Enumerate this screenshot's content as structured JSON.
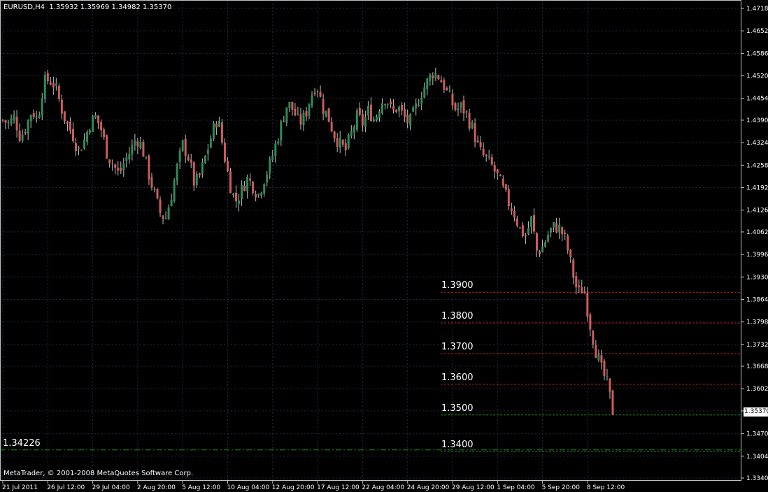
{
  "header": {
    "symbol": "EURUSD,H4",
    "ohlc": "1.35932 1.35969 1.34982 1.35370"
  },
  "footer": {
    "copyright": "MetaTrader, © 2001-2008 MetaQuotes Software Corp."
  },
  "current_price": {
    "label": "1.35370",
    "value": 1.3537
  },
  "colors": {
    "background": "#000000",
    "grid": "#1c2c3c",
    "frame": "#c0c0c0",
    "bull_candle": "#2e8b57",
    "bear_candle": "#cd5c5c",
    "wick": "#c0c0c0",
    "level_line": "#b22222",
    "support_line": "#228b22",
    "price_box": "#ffffff"
  },
  "levels": [
    {
      "label": "1.3900",
      "value": 1.3885,
      "style": "red-dotted"
    },
    {
      "label": "1.3800",
      "value": 1.3795,
      "style": "red-dotted"
    },
    {
      "label": "1.3700",
      "value": 1.3705,
      "style": "red-dotted"
    },
    {
      "label": "1.3600",
      "value": 1.3615,
      "style": "red-dotted"
    },
    {
      "label": "1.3500",
      "value": 1.3525,
      "style": "green-dotted"
    },
    {
      "label": "1.3400",
      "value": 1.3418,
      "style": "green-dotted"
    }
  ],
  "support": {
    "label": "1.34226",
    "value": 1.34226
  },
  "chart_data": {
    "type": "candlestick",
    "y_axis": {
      "ticks": [
        "1.47180",
        "1.46520",
        "1.45860",
        "1.45200",
        "1.44540",
        "1.43900",
        "1.43240",
        "1.42580",
        "1.41920",
        "1.41260",
        "1.40620",
        "1.39960",
        "1.39300",
        "1.38640",
        "1.37980",
        "1.37320",
        "1.36680",
        "1.36020",
        "1.35370",
        "1.34700",
        "1.34040",
        "1.33400"
      ],
      "range": [
        1.334,
        1.4718
      ]
    },
    "x_axis": {
      "ticks": [
        "21 Jul 2011",
        "26 Jul 12:00",
        "29 Jul 04:00",
        "2 Aug 20:00",
        "5 Aug 12:00",
        "10 Aug 04:00",
        "12 Aug 20:00",
        "17 Aug 12:00",
        "22 Aug 04:00",
        "24 Aug 20:00",
        "29 Aug 12:00",
        "1 Sep 04:00",
        "5 Sep 20:00",
        "8 Sep 12:00"
      ]
    },
    "close_path": [
      1.439,
      1.438,
      1.44,
      1.434,
      1.437,
      1.442,
      1.439,
      1.45,
      1.451,
      1.449,
      1.443,
      1.438,
      1.435,
      1.43,
      1.433,
      1.438,
      1.44,
      1.436,
      1.429,
      1.426,
      1.423,
      1.427,
      1.43,
      1.434,
      1.431,
      1.424,
      1.418,
      1.412,
      1.41,
      1.417,
      1.425,
      1.432,
      1.428,
      1.42,
      1.423,
      1.429,
      1.435,
      1.44,
      1.43,
      1.421,
      1.415,
      1.418,
      1.422,
      1.42,
      1.417,
      1.422,
      1.426,
      1.432,
      1.438,
      1.444,
      1.442,
      1.438,
      1.44,
      1.446,
      1.45,
      1.443,
      1.44,
      1.435,
      1.432,
      1.43,
      1.435,
      1.44,
      1.438,
      1.442,
      1.439,
      1.444,
      1.446,
      1.441,
      1.443,
      1.44,
      1.438,
      1.442,
      1.447,
      1.45,
      1.453,
      1.452,
      1.449,
      1.445,
      1.442,
      1.443,
      1.44,
      1.436,
      1.43,
      1.428,
      1.426,
      1.423,
      1.419,
      1.415,
      1.412,
      1.407,
      1.405,
      1.41,
      1.4,
      1.402,
      1.406,
      1.408,
      1.407,
      1.403,
      1.395,
      1.388,
      1.39,
      1.38,
      1.372,
      1.366,
      1.362,
      1.3537
    ]
  }
}
